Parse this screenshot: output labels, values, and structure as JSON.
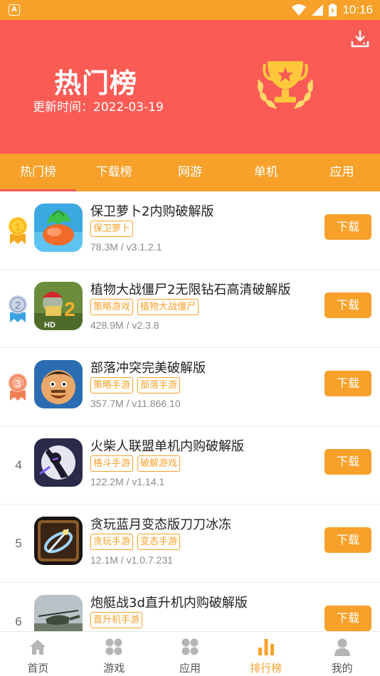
{
  "status_bar": {
    "time": "10:16",
    "left_icon_letter": "A"
  },
  "banner": {
    "title": "热门榜",
    "update_label": "更新时间：2022-03-19"
  },
  "tabs": [
    {
      "label": "热门榜",
      "active": true
    },
    {
      "label": "下载榜",
      "active": false
    },
    {
      "label": "网游",
      "active": false
    },
    {
      "label": "单机",
      "active": false
    },
    {
      "label": "应用",
      "active": false
    }
  ],
  "apps": [
    {
      "rank": "1",
      "title": "保卫萝卜2内购破解版",
      "tags": [
        "保卫萝卜"
      ],
      "meta": "78.3M / v3.1.2.1",
      "button": "下载"
    },
    {
      "rank": "2",
      "title": "植物大战僵尸2无限钻石高清破解版",
      "tags": [
        "策略游戏",
        "植物大战僵尸"
      ],
      "meta": "428.9M / v2.3.8",
      "button": "下载"
    },
    {
      "rank": "3",
      "title": "部落冲突完美破解版",
      "tags": [
        "策略手游",
        "部落手游"
      ],
      "meta": "357.7M / v11.866.10",
      "button": "下载"
    },
    {
      "rank": "4",
      "title": "火柴人联盟单机内购破解版",
      "tags": [
        "格斗手游",
        "破解游戏"
      ],
      "meta": "122.2M / v1.14.1",
      "button": "下载"
    },
    {
      "rank": "5",
      "title": "贪玩蓝月变态版刀刀冰冻",
      "tags": [
        "贪玩手游",
        "变态手游"
      ],
      "meta": "12.1M / v1.0.7.231",
      "button": "下载"
    },
    {
      "rank": "6",
      "title": "炮艇战3d直升机内购破解版",
      "tags": [
        "直升机手游"
      ],
      "meta": "",
      "button": "下载"
    }
  ],
  "bottom_nav": [
    {
      "label": "首页",
      "icon": "home-icon"
    },
    {
      "label": "游戏",
      "icon": "games-grid-icon"
    },
    {
      "label": "应用",
      "icon": "apps-grid-icon"
    },
    {
      "label": "排行榜",
      "icon": "bar-chart-icon",
      "active": true
    },
    {
      "label": "我的",
      "icon": "user-icon"
    }
  ],
  "colors": {
    "accent": "#f7a12a",
    "banner": "#fa5c55"
  }
}
